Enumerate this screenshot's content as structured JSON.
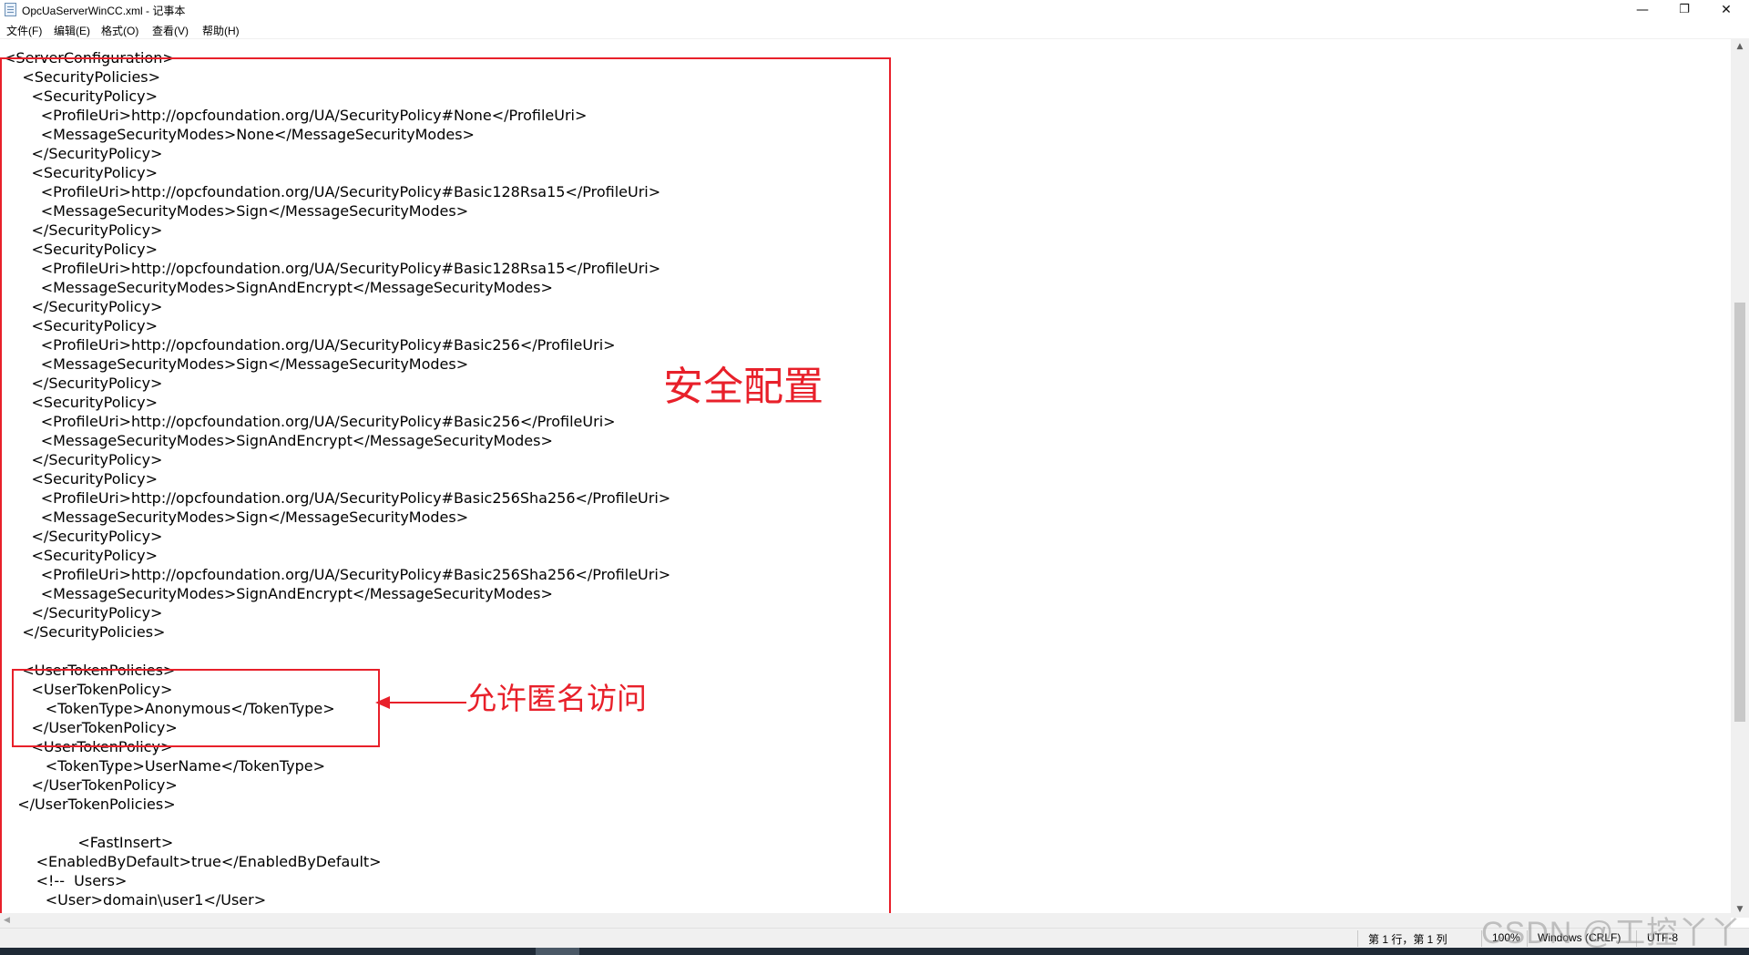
{
  "window": {
    "title": "OpcUaServerWinCC.xml - 记事本",
    "minimize_glyph": "—",
    "maximize_glyph": "❐",
    "close_glyph": "✕"
  },
  "menu": [
    "文件(F)",
    "编辑(E)",
    "格式(O)",
    "查看(V)",
    "帮助(H)"
  ],
  "lines": [
    "<ServerConfiguration>",
    "    <SecurityPolicies>",
    "      <SecurityPolicy>",
    "        <ProfileUri>http://opcfoundation.org/UA/SecurityPolicy#None</ProfileUri>",
    "        <MessageSecurityModes>None</MessageSecurityModes>",
    "      </SecurityPolicy>",
    "      <SecurityPolicy>",
    "        <ProfileUri>http://opcfoundation.org/UA/SecurityPolicy#Basic128Rsa15</ProfileUri>",
    "        <MessageSecurityModes>Sign</MessageSecurityModes>",
    "      </SecurityPolicy>",
    "      <SecurityPolicy>",
    "        <ProfileUri>http://opcfoundation.org/UA/SecurityPolicy#Basic128Rsa15</ProfileUri>",
    "        <MessageSecurityModes>SignAndEncrypt</MessageSecurityModes>",
    "      </SecurityPolicy>",
    "      <SecurityPolicy>",
    "        <ProfileUri>http://opcfoundation.org/UA/SecurityPolicy#Basic256</ProfileUri>",
    "        <MessageSecurityModes>Sign</MessageSecurityModes>",
    "      </SecurityPolicy>",
    "      <SecurityPolicy>",
    "        <ProfileUri>http://opcfoundation.org/UA/SecurityPolicy#Basic256</ProfileUri>",
    "        <MessageSecurityModes>SignAndEncrypt</MessageSecurityModes>",
    "      </SecurityPolicy>",
    "      <SecurityPolicy>",
    "        <ProfileUri>http://opcfoundation.org/UA/SecurityPolicy#Basic256Sha256</ProfileUri>",
    "        <MessageSecurityModes>Sign</MessageSecurityModes>",
    "      </SecurityPolicy>",
    "      <SecurityPolicy>",
    "        <ProfileUri>http://opcfoundation.org/UA/SecurityPolicy#Basic256Sha256</ProfileUri>",
    "        <MessageSecurityModes>SignAndEncrypt</MessageSecurityModes>",
    "      </SecurityPolicy>",
    "    </SecurityPolicies>",
    "",
    "    <UserTokenPolicies>",
    "      <UserTokenPolicy>",
    "         <TokenType>Anonymous</TokenType>",
    "      </UserTokenPolicy>",
    "      <UserTokenPolicy>",
    "         <TokenType>UserName</TokenType>",
    "      </UserTokenPolicy>",
    "   </UserTokenPolicies>",
    "",
    "                <FastInsert>",
    "       <EnabledByDefault>true</EnabledByDefault>",
    "       <!--  Users>",
    "         <User>domain\\user1</User>"
  ],
  "annotations": {
    "security_label": "安全配置",
    "anonymous_label": "允许匿名访问",
    "color": "#e8202a"
  },
  "status": {
    "position": "第 1 行，第 1 列",
    "zoom": "100%",
    "line_ending": "Windows (CRLF)",
    "encoding": "UTF-8"
  },
  "watermark": "CSDN @工控丫丫"
}
